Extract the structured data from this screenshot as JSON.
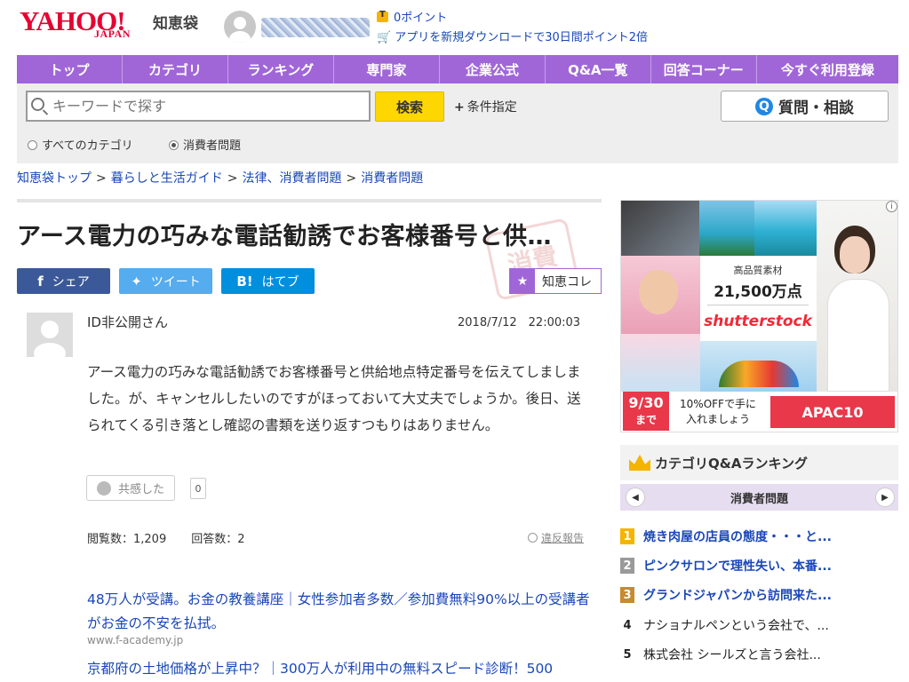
{
  "header": {
    "logo_text": "YAHOO!",
    "logo_sub": "JAPAN",
    "site_name": "知恵袋",
    "points": "0ポイント",
    "app_promo": "アプリを新規ダウンロードで30日間ポイント2倍"
  },
  "nav": {
    "items": [
      {
        "label": "トップ"
      },
      {
        "label": "カテゴリ"
      },
      {
        "label": "ランキング"
      },
      {
        "label": "専門家"
      },
      {
        "label": "企業公式"
      },
      {
        "label": "Q&A一覧"
      },
      {
        "label": "回答コーナー"
      },
      {
        "label": "今すぐ利用登録"
      }
    ]
  },
  "search": {
    "placeholder": "キーワードで探す",
    "button_label": "検索",
    "conditions_label": "条件指定",
    "ask_label": "質問・相談",
    "ask_icon": "Q",
    "scope_all": "すべてのカテゴリ",
    "scope_current": "消費者問題"
  },
  "breadcrumb": {
    "items": [
      "知恵袋トップ",
      "暮らしと生活ガイド",
      "法律、消費者問題",
      "消費者問題"
    ],
    "separator": ">"
  },
  "question": {
    "title": "アース電力の巧みな電話勧誘でお客様番号と供…",
    "stamp_text": "消費",
    "share_fb": "シェア",
    "share_fb_icon": "f",
    "share_tw": "ツイート",
    "share_tw_icon": "✦",
    "share_hb": "はてブ",
    "share_hb_icon": "B!",
    "chie_kore": "知恵コレ",
    "user": "ID非公開さん",
    "date": "2018/7/12　22:00:03",
    "body": "アース電力の巧みな電話勧誘でお客様番号と供給地点特定番号を伝えてしましました。が、キャンセルしたいのですがほっておいて大丈夫でしょうか。後日、送られてくる引き落とし確認の書類を送り返すつもりはありません。",
    "empathy_label": "共感した",
    "empathy_count": "0",
    "views": "閲覧数：1,209",
    "answers": "回答数：2",
    "report": "違反報告"
  },
  "ads": {
    "ad1_text": "48万人が受講。お金の教養講座｜女性参加者多数／参加費無料90%以上の受講者がお金の不安を払拭。",
    "ad1_url": "www.f-academy.jp",
    "ad2_text": "京都府の土地価格が上昇中？｜300万人が利用中の無料スピード診断！500"
  },
  "banner": {
    "sub": "高品質素材",
    "main": "21,500万点",
    "brand": "shutterstock",
    "date_line1": "9/30",
    "date_line2": "まで",
    "off_line1": "10%OFFで手に",
    "off_line2": "入れましょう",
    "code": "APAC10",
    "info_icon": "i"
  },
  "ranking": {
    "title": "カテゴリQ&Aランキング",
    "category": "消費者問題",
    "items": [
      {
        "rank": "1",
        "label": "焼き肉屋の店員の態度・・・と..."
      },
      {
        "rank": "2",
        "label": "ピンクサロンで理性失い、本番..."
      },
      {
        "rank": "3",
        "label": "グランドジャパンから訪問来た..."
      },
      {
        "rank": "4",
        "label": "ナショナルペンという会社で、..."
      },
      {
        "rank": "5",
        "label": "株式会社 シールズと言う会社..."
      }
    ]
  },
  "colors": {
    "nav_purple": "#a066d8",
    "logo_red": "#e60033",
    "link_blue": "#1a47b8",
    "search_yellow": "#ffd700",
    "rank1": "#f5b400",
    "rank2": "#9a9a9a",
    "rank3": "#c88a2e"
  }
}
